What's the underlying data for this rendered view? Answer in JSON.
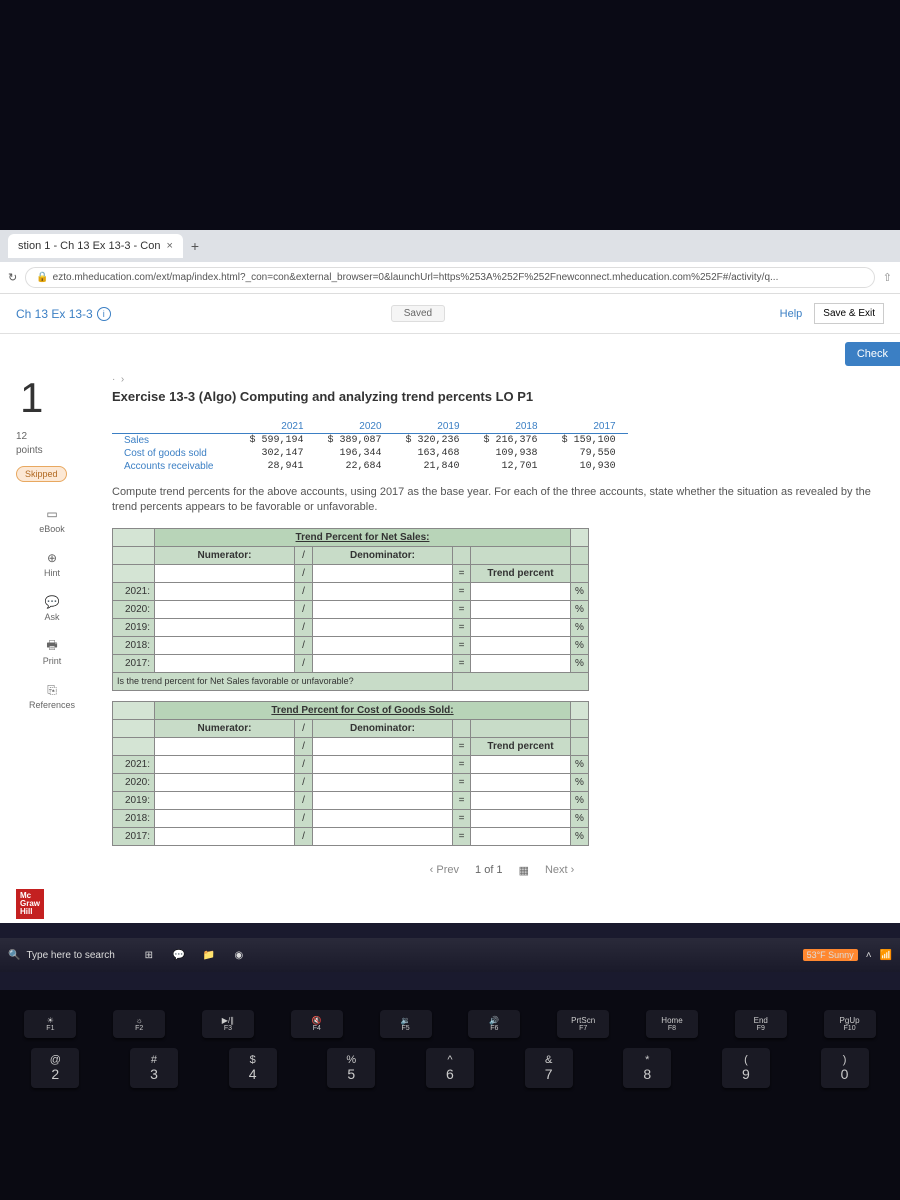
{
  "browser": {
    "tab_title": "stion 1 - Ch 13 Ex 13-3 - Con",
    "url": "ezto.mheducation.com/ext/map/index.html?_con=con&external_browser=0&launchUrl=https%253A%252F%252Fnewconnect.mheducation.com%252F#/activity/q..."
  },
  "header": {
    "title": "Ch 13 Ex 13-3",
    "saved": "Saved",
    "help": "Help",
    "save_exit": "Save & Exit",
    "check": "Check"
  },
  "question": {
    "number": "1",
    "points": "12",
    "points_label": "points",
    "skipped": "Skipped",
    "title": "Exercise 13-3 (Algo) Computing and analyzing trend percents LO P1",
    "instructions": "Compute trend percents for the above accounts, using 2017 as the base year. For each of the three accounts, state whether the situation as revealed by the trend percents appears to be favorable or unfavorable."
  },
  "sidebar": {
    "ebook": "eBook",
    "hint": "Hint",
    "ask": "Ask",
    "print": "Print",
    "references": "References"
  },
  "chart_data": {
    "type": "table",
    "columns": [
      "",
      "2021",
      "2020",
      "2019",
      "2018",
      "2017"
    ],
    "rows": [
      {
        "label": "Sales",
        "values": [
          "$ 599,194",
          "$ 389,087",
          "$ 320,236",
          "$ 216,376",
          "$ 159,100"
        ]
      },
      {
        "label": "Cost of goods sold",
        "values": [
          "302,147",
          "196,344",
          "163,468",
          "109,938",
          "79,550"
        ]
      },
      {
        "label": "Accounts receivable",
        "values": [
          "28,941",
          "22,684",
          "21,840",
          "12,701",
          "10,930"
        ]
      }
    ]
  },
  "worksheets": {
    "sheet1": {
      "title": "Trend Percent for Net Sales:",
      "numerator": "Numerator:",
      "denominator": "Denominator:",
      "trend_percent": "Trend percent",
      "years": [
        "2021:",
        "2020:",
        "2019:",
        "2018:",
        "2017:"
      ],
      "question": "Is the trend percent for Net Sales favorable or unfavorable?"
    },
    "sheet2": {
      "title": "Trend Percent for Cost of Goods Sold:",
      "numerator": "Numerator:",
      "denominator": "Denominator:",
      "trend_percent": "Trend percent",
      "years": [
        "2021:",
        "2020:",
        "2019:",
        "2018:",
        "2017:"
      ]
    }
  },
  "pager": {
    "prev": "Prev",
    "page": "1 of 1",
    "next": "Next"
  },
  "logo": {
    "line1": "Mc",
    "line2": "Graw",
    "line3": "Hill"
  },
  "taskbar": {
    "search": "Type here to search",
    "weather": "53°F Sunny"
  },
  "keyboard": {
    "fn_row": [
      {
        "top": "",
        "bot": "F1",
        "sym": "☀"
      },
      {
        "top": "",
        "bot": "F2",
        "sym": "☼"
      },
      {
        "top": "▶/∥",
        "bot": "F3",
        "sym": ""
      },
      {
        "top": "🔇",
        "bot": "F4",
        "sym": ""
      },
      {
        "top": "🔉",
        "bot": "F5",
        "sym": ""
      },
      {
        "top": "🔊",
        "bot": "F6",
        "sym": ""
      },
      {
        "top": "PrtScn",
        "bot": "F7",
        "sym": ""
      },
      {
        "top": "Home",
        "bot": "F8",
        "sym": ""
      },
      {
        "top": "End",
        "bot": "F9",
        "sym": ""
      },
      {
        "top": "PgUp",
        "bot": "F10",
        "sym": ""
      }
    ],
    "num_row": [
      {
        "u": "@",
        "l": "2"
      },
      {
        "u": "#",
        "l": "3"
      },
      {
        "u": "$",
        "l": "4"
      },
      {
        "u": "%",
        "l": "5"
      },
      {
        "u": "^",
        "l": "6"
      },
      {
        "u": "&",
        "l": "7"
      },
      {
        "u": "*",
        "l": "8"
      },
      {
        "u": "(",
        "l": "9"
      },
      {
        "u": ")",
        "l": "0"
      }
    ]
  }
}
